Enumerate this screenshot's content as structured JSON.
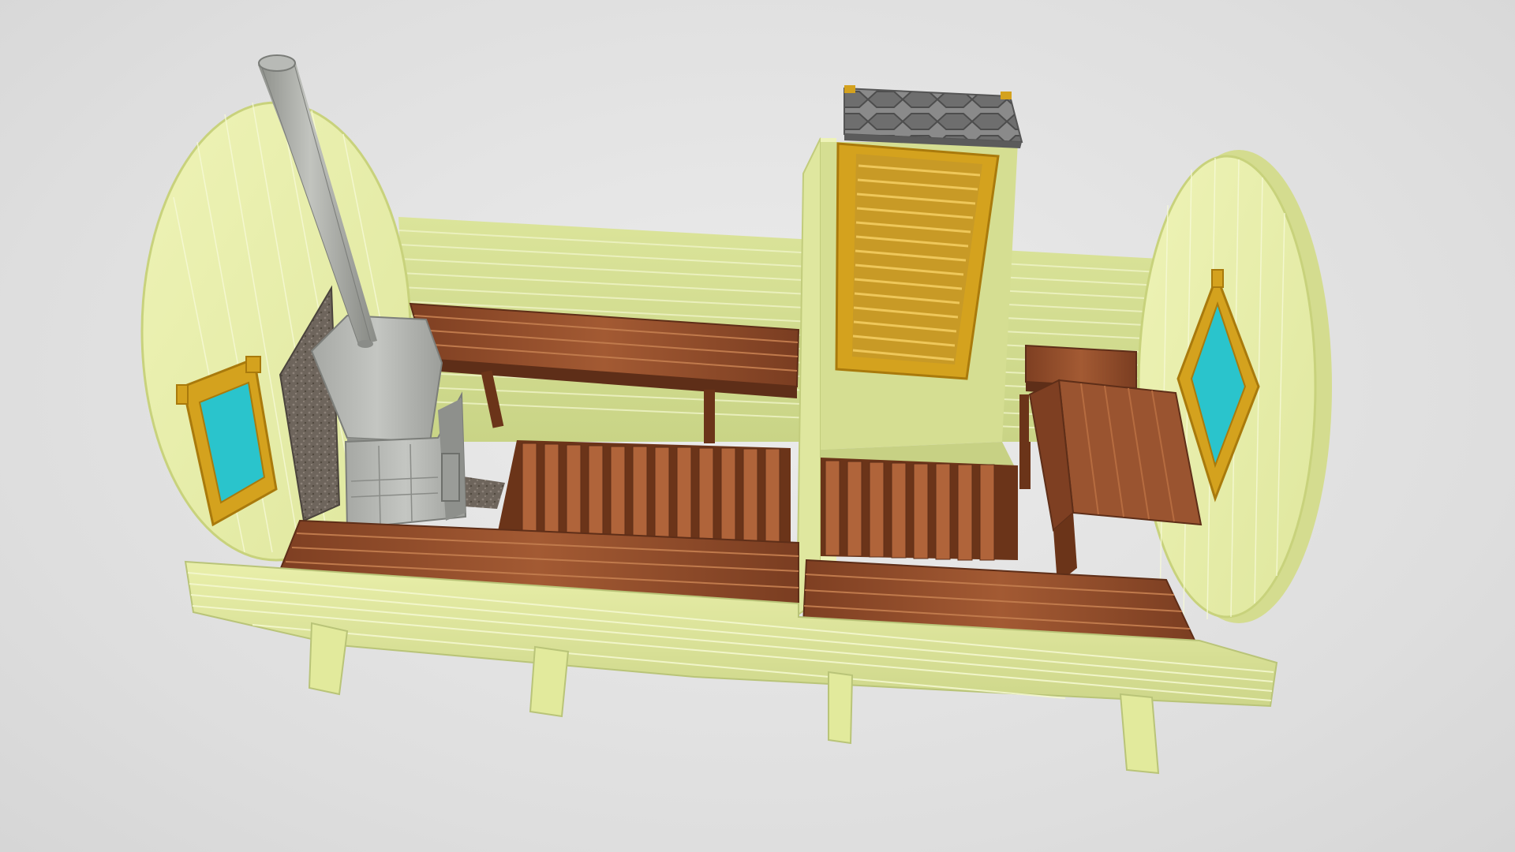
{
  "scene": {
    "subject": "barrel-sauna-cutaway-3d-model",
    "colors": {
      "background": "#e3e3e3",
      "barrel_wood": "#e6eda4",
      "barrel_wood_shade": "#cfd98a",
      "barrel_wood_dark": "#b9c478",
      "plank_line": "#f4f8cf",
      "bench_wood": "#8e4a2a",
      "bench_wood_light": "#b0643a",
      "bench_wood_dark": "#5e2e18",
      "frame_gold": "#d4a21e",
      "frame_gold_dark": "#a97a0c",
      "glass": "#2ac4cc",
      "stove_metal": "#b4b6b2",
      "stove_metal_dark": "#8e908c",
      "chimney": "#a9aba6",
      "granite": "#6b625a",
      "roof_stone": "#7a7a7a"
    },
    "icons": [
      "chimney-pipe",
      "wood-stove",
      "window",
      "door",
      "bench",
      "duckboard-floor",
      "table"
    ]
  }
}
